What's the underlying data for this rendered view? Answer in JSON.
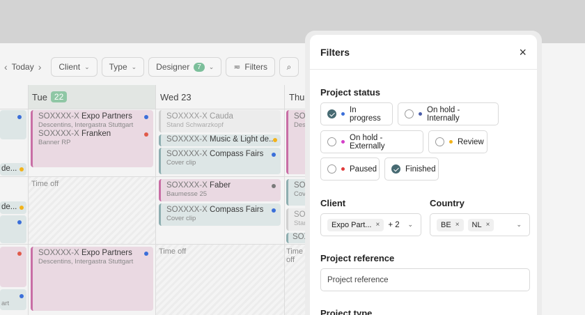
{
  "toolbar": {
    "prev": "‹",
    "today": "Today",
    "next": "›",
    "client": "Client",
    "type": "Type",
    "designer": "Designer",
    "designer_count": "7",
    "filters": "Filters",
    "filters_icon": "≂",
    "search_icon": "⌕",
    "caret": "⌄"
  },
  "calendar": {
    "columns": [
      {
        "label": "Tue",
        "badge": "22"
      },
      {
        "label": "Wed 23"
      },
      {
        "label": "Thu"
      }
    ],
    "time_off": "Time off",
    "events": {
      "tue_a_code": "SOXXXX-X",
      "tue_a_title": "Expo Partners",
      "tue_a_sub": "Descentins, Intergastra Stuttgart",
      "tue_b_code": "SOXXXX-X",
      "tue_b_title": "Franken",
      "tue_b_sub": "Banner RP",
      "wed_a_code": "SOXXXX-X",
      "wed_a_title": "Cauda",
      "wed_a_sub": "Stand Schwarzkopf",
      "wed_b_code": "SOXXXX-X",
      "wed_b_title": "Music & Light de...",
      "wed_c_code": "SOXXXX-X",
      "wed_c_title": "Compass Fairs",
      "wed_c_sub": "Cover clip",
      "wed_d_code": "SOXXXX-X",
      "wed_d_title": "Faber",
      "wed_d_sub": "Baumesse 25",
      "wed_e_code": "SOXXXX-X",
      "wed_e_title": "Compass Fairs",
      "wed_e_sub": "Cover clip",
      "tue_c_code": "SOXXXX-X",
      "tue_c_title": "Expo Partners",
      "tue_c_sub": "Descentins, Intergastra Stuttgart",
      "thu_a": "SOX",
      "thu_a_sub": "Desc",
      "thu_b": "SOX",
      "thu_b_sub": "Cove",
      "thu_c": "SOX",
      "thu_c_sub": "Stan",
      "thu_d": "SOX",
      "left_a": "de...",
      "left_b": "de...",
      "left_c": "art"
    }
  },
  "filters": {
    "title": "Filters",
    "close_icon": "×",
    "project_status_label": "Project status",
    "statuses": [
      {
        "label": "In progress",
        "checked": true,
        "dot": "#3b6fd9"
      },
      {
        "label": "On hold - Internally",
        "checked": false,
        "dot": "#4a5da8"
      },
      {
        "label": "On hold - Externally",
        "checked": false,
        "dot": "#d43fc8"
      },
      {
        "label": "Review",
        "checked": false,
        "dot": "#f2b21a"
      },
      {
        "label": "Paused",
        "checked": false,
        "dot": "#e03a3a"
      },
      {
        "label": "Finished",
        "checked": true,
        "dot": ""
      }
    ],
    "client_label": "Client",
    "client_tag": "Expo Part...",
    "client_more": "+ 2",
    "country_label": "Country",
    "country_tags": [
      "BE",
      "NL"
    ],
    "tag_remove": "×",
    "select_chevron": "⌄",
    "project_reference_label": "Project reference",
    "project_reference_placeholder": "Project reference",
    "project_type_label": "Project type"
  }
}
